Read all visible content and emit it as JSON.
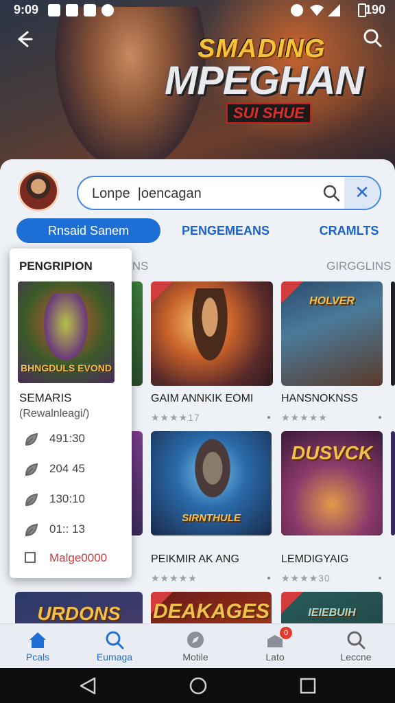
{
  "status_bar": {
    "time": "9:09",
    "battery": "190"
  },
  "hero": {
    "title_line1": "SMADING",
    "title_line2": "MPEGHAN",
    "title_badge": "SUI SHUE"
  },
  "search": {
    "value": "Lonpe  |oencagan"
  },
  "tabs": [
    {
      "label": "Rnsaid Sanem",
      "active": true
    },
    {
      "label": "PENGEMEANS",
      "active": false
    },
    {
      "label": "CRAMLTS",
      "active": false
    }
  ],
  "section": {
    "left_label": "INS",
    "right_label": "GIRGGLINS"
  },
  "cards": [
    {
      "name": "GAIM ANNKIK EOMI",
      "rating": "★★★★17",
      "art": ""
    },
    {
      "name": "HANSNOKNSS",
      "rating": "★★★★★",
      "art": "HOLVER"
    },
    {
      "name": "PEIKMIR AK ANG",
      "rating": "★★★★★",
      "art": "SIRNTHULE"
    },
    {
      "name": "LEMDIGYAIG",
      "rating": "★★★★30",
      "art": "DUSVCK"
    },
    {
      "name": "",
      "rating": "",
      "art": "URDONS"
    },
    {
      "name": "",
      "rating": "",
      "art": "DEAKAGES"
    },
    {
      "name": "",
      "rating": "",
      "art": "IEIEBUIH"
    }
  ],
  "panel": {
    "title": "PENGRIPION",
    "image_logo": "BHNGDULS EVOND",
    "name": "SEMARIS",
    "subtitle": "(Rewalnleagi/)",
    "stats": [
      "491:30",
      "204 45",
      "130:10",
      "01:: 13"
    ],
    "checkbox_label": "Malge0000"
  },
  "bottom_nav": [
    {
      "label": "Pcals",
      "icon": "home-icon",
      "active": true
    },
    {
      "label": "Eumaga",
      "icon": "search-icon",
      "active": true
    },
    {
      "label": "Motile",
      "icon": "compass-icon",
      "active": false
    },
    {
      "label": "Lato",
      "icon": "notification-icon",
      "active": false,
      "badge": "0"
    },
    {
      "label": "Leccne",
      "icon": "search-icon",
      "active": false
    }
  ],
  "colors": {
    "accent": "#1d6fd6",
    "sheet_bg": "#eef1f6",
    "badge": "#e23a2a"
  }
}
